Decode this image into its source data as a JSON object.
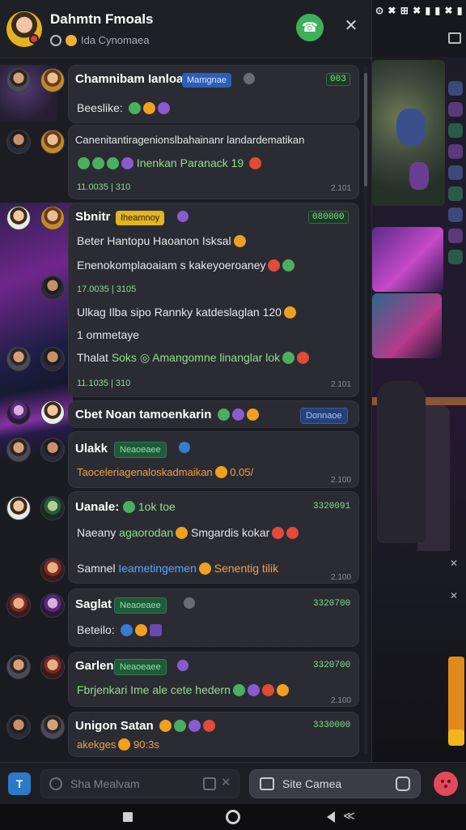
{
  "status_bar": {
    "icons_text": "⊙ ✖ ⊞ ✖ ▮ ▮ ✖ ▮"
  },
  "header": {
    "title": "Dahmtn Fmoals",
    "subtitle": "Ida Cynomaea"
  },
  "messages": [
    {
      "name": "Chamnibam Ianloan",
      "badge": "Mamgnae",
      "count": "003",
      "lines": [
        "Beeslike:"
      ]
    },
    {
      "name": "",
      "lines": [
        "Canenitantiragenionslbahainanr landardematikan"
      ],
      "highlight": "Inenkan Paranack 19",
      "meta": "11.0035 | 310",
      "time": "2.101"
    },
    {
      "name": "Sbnitr",
      "badge": "Iheamnoy",
      "count": "080000",
      "lines": [
        "Beter Hantopu Haoanon Isksal",
        "Enenokomplaoaiam s kakeyoeroaney"
      ],
      "meta": "17.0035 | 3105"
    },
    {
      "name": "",
      "lines": [
        "Ulkag Ilba sipo Rannky katdeslaglan 120",
        "1 ommetaye"
      ],
      "time": ""
    },
    {
      "name": "",
      "line_prefix": "Thalat",
      "highlight": "Soks ◎ Amangomne linanglar lok",
      "meta": "11.1035 | 310",
      "time": "2.101"
    },
    {
      "name": "Cbet Noan tamoenkarin",
      "badge": "Donnaoe",
      "count": "",
      "lines": []
    },
    {
      "name": "Ulakk",
      "badge": "Neaoeaee",
      "orange": "Taoceleriagenaloskadmaikan",
      "orange_tail": "0.05/",
      "time": "2.100"
    },
    {
      "name": "Uanale:",
      "name_suffix": "1ok toe",
      "count": "3320091",
      "lines": [
        "Naeany"
      ],
      "highlight": "agaorodan",
      "line_tail": "Smgardis kokar"
    },
    {
      "name": "",
      "line_prefix": "Samnel",
      "blue": "Ieametingemen",
      "orange": "Senentig tilik",
      "time": "2.100"
    },
    {
      "name": "Saglat",
      "badge": "Neaoeaee",
      "count": "3320700",
      "lines": [
        "Beteilo:"
      ]
    },
    {
      "name": "Garlen",
      "badge": "Neaoeaee",
      "count": "3320700",
      "highlight": "Fbrjenkari Ime ale cete hedern",
      "time": "2.100"
    },
    {
      "name": "Unigon Satan",
      "count": "3330000",
      "orange": "akekges",
      "orange_tail": "90:3s"
    }
  ],
  "composer": {
    "left_button": "T",
    "placeholder": "Sha Mealvam",
    "pill_label": "Site Camea"
  },
  "colors": {
    "accent_green": "#3fb05a",
    "badge_blue": "#2b5fb8",
    "badge_yellow": "#e2b622",
    "text_green": "#8fe08a",
    "text_orange": "#f0a040"
  }
}
